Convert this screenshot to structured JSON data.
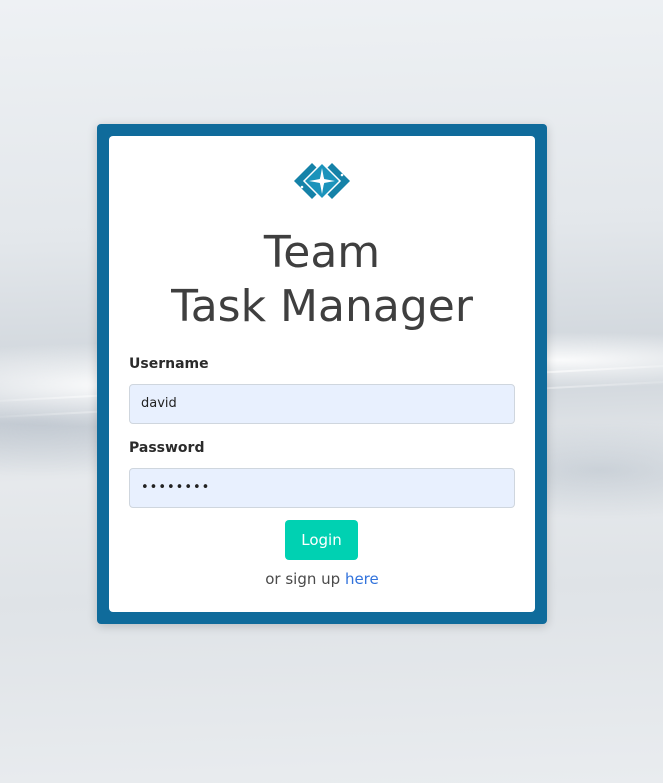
{
  "title": {
    "line1": "Team",
    "line2": "Task Manager"
  },
  "logo": {
    "icon": "diamond-star-logo-icon"
  },
  "form": {
    "username_label": "Username",
    "username_value": "david",
    "password_label": "Password",
    "password_value": "••••••••",
    "login_label": "Login"
  },
  "signup": {
    "prefix": "or sign up",
    "link_text": "here"
  },
  "colors": {
    "card_border": "#0f6b9b",
    "primary_button": "#00d1b2",
    "link": "#3273dc",
    "input_background": "#e8f0fe"
  }
}
